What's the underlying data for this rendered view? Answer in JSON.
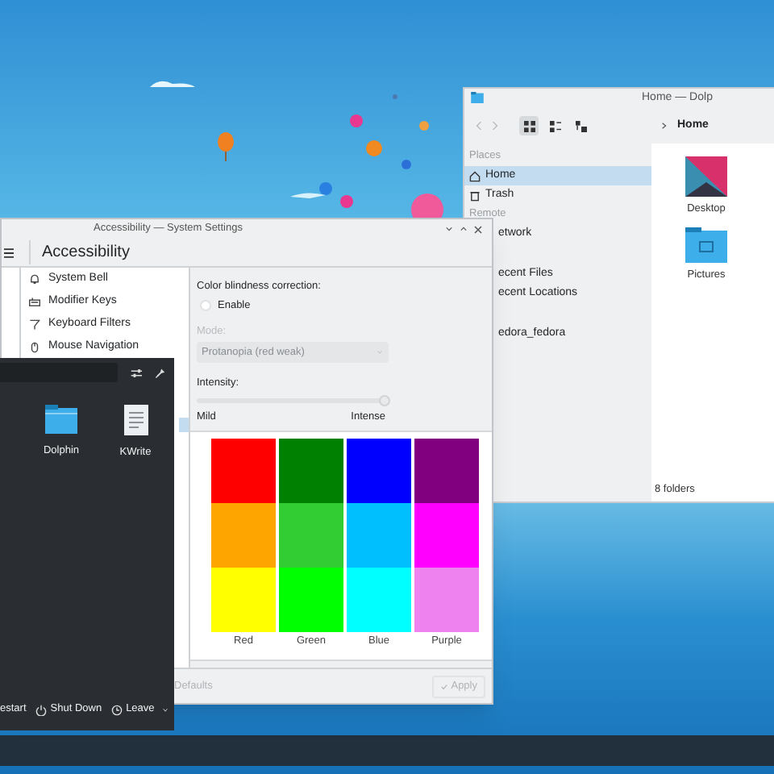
{
  "file_manager": {
    "title": "Home — Dolp",
    "breadcrumb": "Home",
    "places": [
      {
        "kind": "header",
        "label": "Places"
      },
      {
        "kind": "item",
        "label": "Home",
        "selected": true
      },
      {
        "kind": "item",
        "label": "Trash",
        "selected": false
      },
      {
        "kind": "header",
        "label": "Remote"
      },
      {
        "kind": "cut",
        "label": "etwork",
        "selected": false
      },
      {
        "kind": "cut",
        "label": "ecent Files",
        "selected": false
      },
      {
        "kind": "cut",
        "label": "ecent Locations",
        "selected": false
      },
      {
        "kind": "cut",
        "label": "edora_fedora",
        "selected": false
      }
    ],
    "files": [
      {
        "kind": "desktop",
        "name": "Desktop"
      },
      {
        "kind": "pictures",
        "name": "Pictures"
      }
    ],
    "status": "8 folders"
  },
  "settings": {
    "title": "Accessibility — System Settings",
    "heading": "Accessibility",
    "modules": [
      {
        "label": "System Bell"
      },
      {
        "label": "Modifier Keys"
      },
      {
        "label": "Keyboard Filters"
      },
      {
        "label": "Mouse Navigation"
      }
    ],
    "section": "Color blindness correction:",
    "enable": {
      "label": "Enable",
      "checked": false
    },
    "mode": {
      "label": "Mode:",
      "value": "Protanopia (red weak)",
      "disabled": true
    },
    "intensity": {
      "label": "Intensity:",
      "level": 1.0,
      "min_label": "Mild",
      "max_label": "Intense"
    },
    "swatch_columns": [
      {
        "label": "Red",
        "swatches": [
          {
            "color": "#ff0000"
          },
          {
            "color": "#ffa500"
          },
          {
            "color": "#ffff00"
          }
        ]
      },
      {
        "label": "Green",
        "swatches": [
          {
            "color": "#008000"
          },
          {
            "color": "#32cd32"
          },
          {
            "color": "#00ff00"
          }
        ]
      },
      {
        "label": "Blue",
        "swatches": [
          {
            "color": "#0000ff"
          },
          {
            "color": "#00bfff"
          },
          {
            "color": "#00ffff"
          }
        ]
      },
      {
        "label": "Purple",
        "swatches": [
          {
            "color": "#800080"
          },
          {
            "color": "#ff00ff"
          },
          {
            "color": "#ee82ee"
          }
        ]
      }
    ],
    "defaults_button": "Defaults",
    "apply_button": {
      "label": "Apply",
      "disabled": true
    }
  },
  "launcher": {
    "apps": [
      {
        "kind": "folder",
        "name": "Dolphin"
      },
      {
        "kind": "text",
        "name": "KWrite"
      }
    ],
    "power": [
      {
        "kind": "restart",
        "label": "estart"
      },
      {
        "kind": "shutdown",
        "label": "Shut Down"
      },
      {
        "kind": "leave",
        "label": "Leave"
      }
    ]
  }
}
